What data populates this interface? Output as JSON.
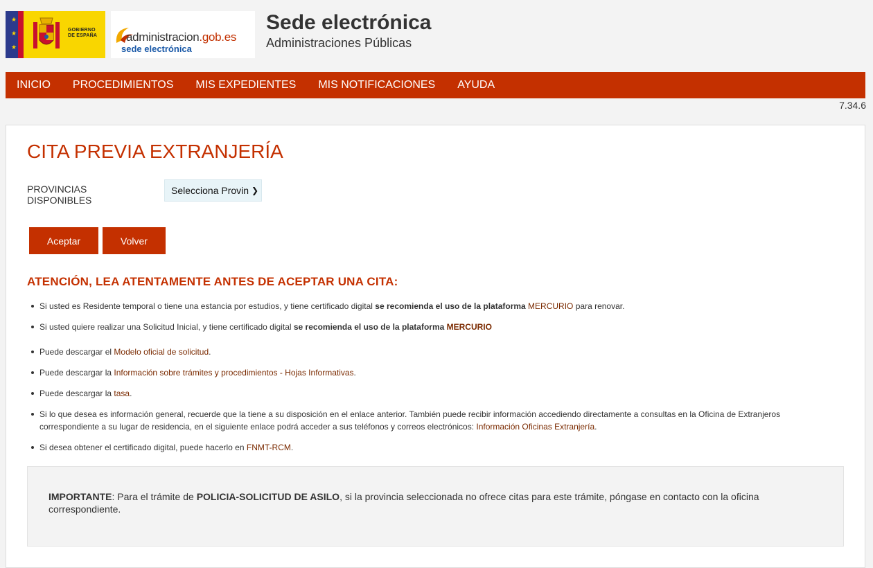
{
  "header": {
    "gov_logo_text": "GOBIERNO DE ESPAÑA",
    "adm_logo_main": "administracion",
    "adm_logo_domain": ".gob.es",
    "adm_logo_sub": "sede electrónica",
    "title": "Sede electrónica",
    "subtitle": "Administraciones Públicas"
  },
  "nav": {
    "items": [
      {
        "label": "INICIO"
      },
      {
        "label": "PROCEDIMIENTOS"
      },
      {
        "label": "MIS EXPEDIENTES"
      },
      {
        "label": "MIS NOTIFICACIONES"
      },
      {
        "label": "AYUDA"
      }
    ]
  },
  "version": "7.34.6",
  "main": {
    "title": "CITA PREVIA EXTRANJERÍA",
    "provinces_label": "PROVINCIAS DISPONIBLES",
    "provinces_select_value": "Selecciona Provincia",
    "accept_label": "Aceptar",
    "back_label": "Volver",
    "attention": "ATENCIÓN, LEA ATENTAMENTE ANTES DE ACEPTAR UNA CITA:",
    "notes": {
      "n1_a": "Si usted es Residente temporal o tiene una estancia por estudios, y tiene certificado digital ",
      "n1_b": "se recomienda el uso de la plataforma ",
      "n1_link": "MERCURIO",
      "n1_c": " para renovar.",
      "n2_a": "Si usted quiere realizar una Solicitud Inicial, y tiene certificado digital ",
      "n2_b": "se recomienda el uso de la plataforma ",
      "n2_link": "MERCURIO",
      "n3_a": "Puede descargar el ",
      "n3_link": "Modelo oficial de solicitud",
      "n3_c": ".",
      "n4_a": "Puede descargar la ",
      "n4_link": "Información sobre trámites y procedimientos - Hojas Informativas",
      "n4_c": ".",
      "n5_a": "Puede descargar la ",
      "n5_link": "tasa",
      "n5_c": ".",
      "n6_a": "Si lo que desea es información general, recuerde que la tiene a su disposición en el enlace anterior. También puede recibir información accediendo directamente a consultas en la Oficina de Extranjeros correspondiente a su lugar de residencia, en el siguiente enlace podrá acceder a sus teléfonos y correos electrónicos: ",
      "n6_link": "Información Oficinas Extranjería",
      "n6_c": ".",
      "n7_a": "Si desea obtener el certificado digital, puede hacerlo en ",
      "n7_link": "FNMT-RCM",
      "n7_c": "."
    },
    "important": {
      "label": "IMPORTANTE",
      "text_a": ": Para el trámite de ",
      "procedure": "POLICIA-SOLICITUD DE ASILO",
      "text_b": ", si la provincia seleccionada no ofrece citas para este trámite, póngase en contacto con la oficina correspondiente."
    }
  },
  "colors": {
    "accent": "#c43000",
    "link": "#7a2a00",
    "select_bg": "#e8f4f8"
  }
}
